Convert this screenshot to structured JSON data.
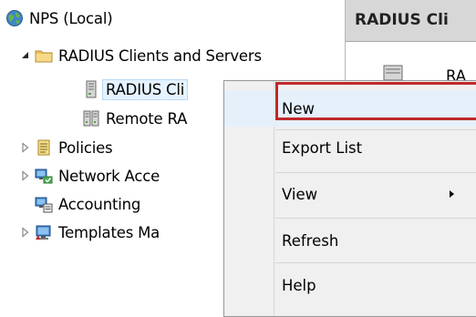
{
  "tree": {
    "root": {
      "label": "NPS (Local)",
      "icon": "nps-globe-icon"
    },
    "radius_group": {
      "label": "RADIUS Clients and Servers",
      "icon": "folder-icon"
    },
    "radius_clients": {
      "label": "RADIUS Cli",
      "icon": "server-icon"
    },
    "remote_radius": {
      "label": "Remote RA",
      "icon": "server-group-icon"
    },
    "policies": {
      "label": "Policies",
      "icon": "policies-icon"
    },
    "network_access": {
      "label": "Network Acce",
      "icon": "network-access-icon"
    },
    "accounting": {
      "label": "Accounting",
      "icon": "accounting-icon"
    },
    "templates": {
      "label": "Templates Ma",
      "icon": "templates-icon"
    }
  },
  "right_pane": {
    "header": "RADIUS Cli",
    "item_label": "RA"
  },
  "context_menu": {
    "items": [
      {
        "label": "New"
      },
      {
        "label": "Export List"
      },
      {
        "label": "View"
      },
      {
        "label": "Refresh"
      },
      {
        "label": "Help"
      }
    ]
  },
  "colors": {
    "highlight_border": "#c0282a",
    "selection_bg": "#e5f3ff",
    "header_bg": "#d7d7d7"
  }
}
